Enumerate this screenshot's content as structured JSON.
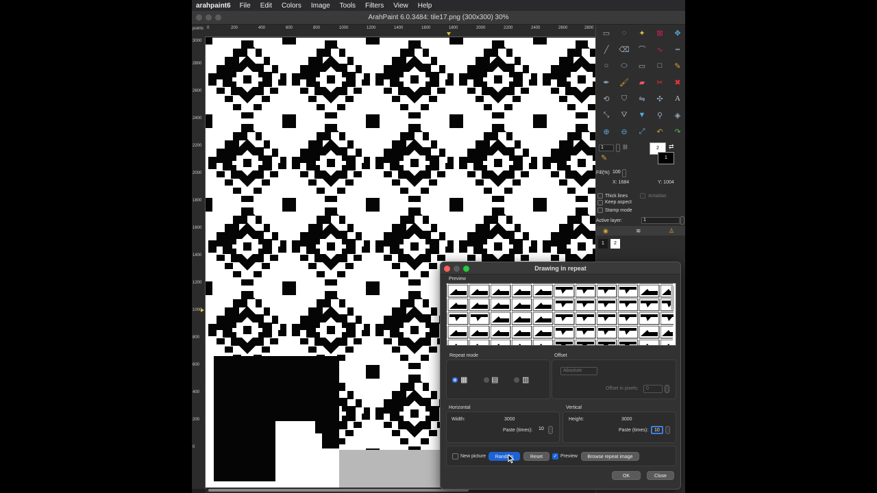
{
  "menubar": {
    "app_name": "arahpaint6",
    "items": [
      "File",
      "Edit",
      "Colors",
      "Image",
      "Tools",
      "Filters",
      "View",
      "Help"
    ]
  },
  "window": {
    "title": "ArahPaint 6.0.3484: tile17.png  (300x300) 30%"
  },
  "rulers": {
    "unit": "points",
    "h_ticks": [
      "0",
      "200",
      "400",
      "600",
      "800",
      "1000",
      "1200",
      "1400",
      "1600",
      "1800",
      "2000",
      "2200",
      "2400",
      "2600",
      "2800"
    ],
    "v_ticks": [
      "3000",
      "2800",
      "2600",
      "2400",
      "2200",
      "2000",
      "1800",
      "1600",
      "1400",
      "1200",
      "1000",
      "800",
      "600",
      "400",
      "200",
      "0"
    ]
  },
  "right_panel": {
    "tools": [
      "rect-select-icon",
      "lasso-icon",
      "magic-wand-icon",
      "crop-icon",
      "move-icon",
      "line-icon",
      "eraser-icon",
      "curve-icon",
      "bezier-icon",
      "dashed-icon",
      "circle-icon",
      "ellipse-icon",
      "rectangle-icon",
      "square-icon",
      "pencil-icon",
      "pen-icon",
      "brush-icon",
      "pink-eraser-icon",
      "scissors-icon",
      "red-x-icon",
      "rotate-icon",
      "stamp-icon",
      "mirror-icon",
      "symmetry-icon",
      "text-icon",
      "resize-icon",
      "fill-icon",
      "gradient-icon",
      "compass-icon",
      "bucket-icon",
      "zoom-in-icon",
      "zoom-out-icon",
      "fit-icon",
      "undo-icon",
      "redo-icon"
    ],
    "size_value": "1",
    "fg_color_index": "2",
    "bg_color_index": "1",
    "fill_label": "Fill(%)",
    "fill_value": "100",
    "x_label": "X: 1684",
    "y_label": "Y: 1004",
    "thick_lines": "Thick lines",
    "antialias": "Antialias",
    "keep_aspect": "Keep aspect",
    "stamp_mode": "Stamp mode",
    "active_layer_label": "Active layer:",
    "active_layer_value": "1",
    "layers": [
      "1",
      "2"
    ]
  },
  "dialog": {
    "title": "Drawing in repeat",
    "preview_label": "Preview",
    "repeat_mode_label": "Repeat mode",
    "offset_label": "Offset",
    "offset_mode": "Absolute",
    "offset_in_pixels_label": "Offset in pixels:",
    "offset_in_pixels_value": "0",
    "horizontal_label": "Horizontal",
    "vertical_label": "Vertical",
    "width_label": "Width:",
    "width_value": "3000",
    "height_label": "Height:",
    "height_value": "3000",
    "paste_label": "Paste (times):",
    "h_paste_value": "10",
    "v_paste_value": "10",
    "new_picture_label": "New picture",
    "random_label": "Random",
    "reset_label": "Reset",
    "preview_check_label": "Preview",
    "browse_label": "Browse repeat image",
    "ok_label": "OK",
    "close_label": "Close"
  }
}
